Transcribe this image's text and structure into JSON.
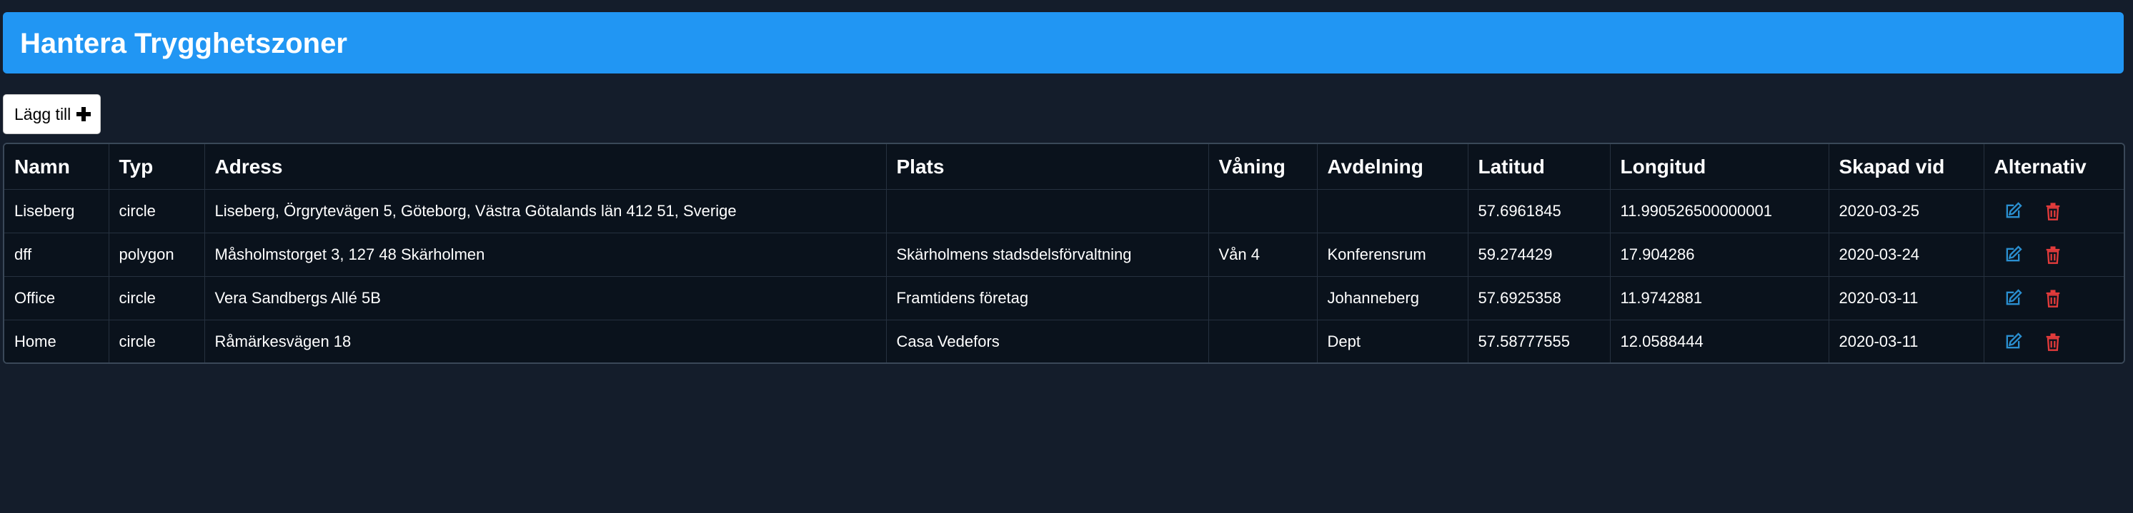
{
  "header": {
    "title": "Hantera Trygghetszoner"
  },
  "toolbar": {
    "add_label": "Lägg till",
    "add_icon": "plus-icon"
  },
  "table": {
    "columns": [
      "Namn",
      "Typ",
      "Adress",
      "Plats",
      "Våning",
      "Avdelning",
      "Latitud",
      "Longitud",
      "Skapad vid",
      "Alternativ"
    ],
    "rows": [
      {
        "namn": "Liseberg",
        "typ": "circle",
        "adress": "Liseberg, Örgrytevägen 5, Göteborg, Västra Götalands län 412 51, Sverige",
        "plats": "",
        "vaning": "",
        "avdelning": "",
        "latitud": "57.6961845",
        "longitud": "11.990526500000001",
        "skapad": "2020-03-25"
      },
      {
        "namn": "dff",
        "typ": "polygon",
        "adress": "Måsholmstorget 3, 127 48 Skärholmen",
        "plats": "Skärholmens stadsdelsförvaltning",
        "vaning": "Vån 4",
        "avdelning": "Konferensrum",
        "latitud": "59.274429",
        "longitud": "17.904286",
        "skapad": "2020-03-24"
      },
      {
        "namn": "Office",
        "typ": "circle",
        "adress": "Vera Sandbergs Allé 5B",
        "plats": "Framtidens företag",
        "vaning": "",
        "avdelning": "Johanneberg",
        "latitud": "57.6925358",
        "longitud": "11.9742881",
        "skapad": "2020-03-11"
      },
      {
        "namn": "Home",
        "typ": "circle",
        "adress": "Råmärkesvägen 18",
        "plats": "Casa Vedefors",
        "vaning": "",
        "avdelning": "Dept",
        "latitud": "57.58777555",
        "longitud": "12.0588444",
        "skapad": "2020-03-11"
      }
    ],
    "actions": {
      "edit_icon": "edit-icon",
      "delete_icon": "trash-icon"
    }
  },
  "colors": {
    "background": "#141d2b",
    "header": "#2196f3",
    "table_bg": "#0a121c",
    "border": "#3a4858",
    "edit": "#2a8fd0",
    "delete": "#e23b3b"
  }
}
